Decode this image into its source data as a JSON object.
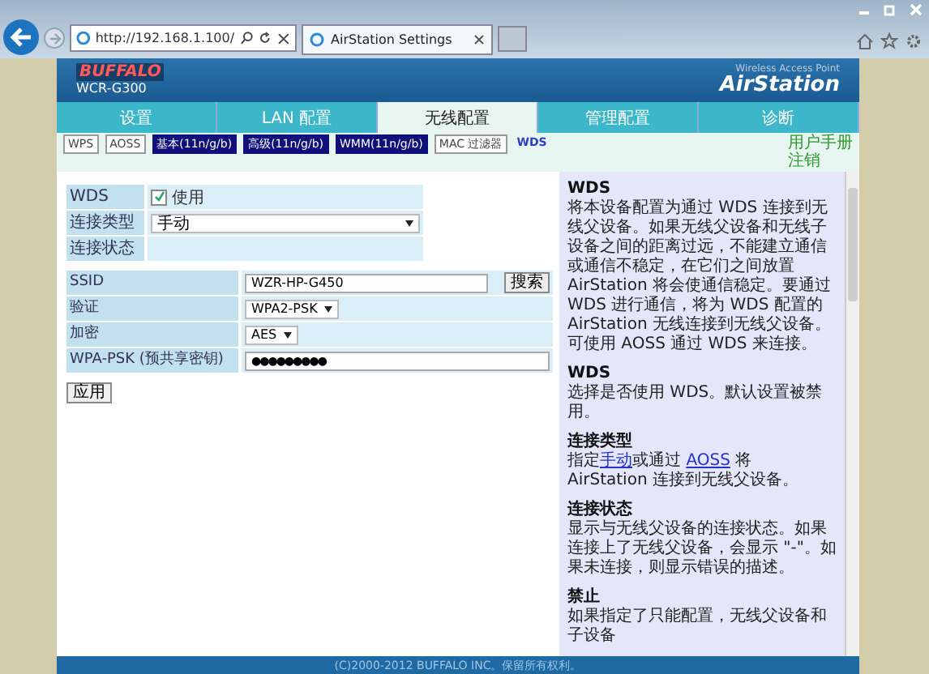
{
  "browser": {
    "url": "http://192.168.1.100/",
    "tab_title": "AirStation Settings"
  },
  "header": {
    "brand": "BUFFALO",
    "model": "WCR-G300",
    "product_sub": "Wireless Access Point",
    "product": "AirStation"
  },
  "nav_tabs": [
    {
      "label": "设置",
      "selected": false
    },
    {
      "label": "LAN 配置",
      "selected": false
    },
    {
      "label": "无线配置",
      "selected": true
    },
    {
      "label": "管理配置",
      "selected": false
    },
    {
      "label": "诊断",
      "selected": false
    }
  ],
  "sub_tabs": [
    {
      "label": "WPS",
      "kind": "plain"
    },
    {
      "label": "AOSS",
      "kind": "plain"
    },
    {
      "label": "基本(11n/g/b)",
      "kind": "filled"
    },
    {
      "label": "高级(11n/g/b)",
      "kind": "filled"
    },
    {
      "label": "WMM(11n/g/b)",
      "kind": "filled"
    },
    {
      "label": "MAC 过滤器",
      "kind": "plain"
    },
    {
      "label": "WDS",
      "kind": "current"
    }
  ],
  "user_links": [
    "用户手册",
    "注销"
  ],
  "wds_rows": [
    {
      "label": "WDS",
      "kind": "checkbox",
      "checked": true,
      "value": "使用"
    },
    {
      "label": "连接类型",
      "kind": "select",
      "value": "手动"
    },
    {
      "label": "连接状态",
      "kind": "empty"
    }
  ],
  "link_rows": [
    {
      "label": "SSID",
      "kind": "text",
      "value": "WZR-HP-G450",
      "button": "搜索"
    },
    {
      "label": "验证",
      "kind": "select",
      "value": "WPA2-PSK"
    },
    {
      "label": "加密",
      "kind": "select",
      "value": "AES"
    },
    {
      "label": "WPA-PSK (预共享密钥)",
      "kind": "password",
      "value": "●●●●●●●●●"
    }
  ],
  "apply_button": "应用",
  "help": [
    {
      "heading": "WDS",
      "parts": [
        {
          "kind": "text",
          "text": "将本设备配置为通过 WDS 连接到无线父设备。如果无线父设备和无线子设备之间的距离过远，不能建立通信或通信不稳定，在它们之间放置 AirStation 将会使通信稳定。要通过 WDS 进行通信，将为 WDS 配置的 AirStation 无线连接到无线父设备。可使用 AOSS 通过 WDS 来连接。"
        }
      ]
    },
    {
      "heading": "WDS",
      "parts": [
        {
          "kind": "text",
          "text": "选择是否使用 WDS。默认设置被禁用。"
        }
      ]
    },
    {
      "heading": "连接类型",
      "parts": [
        {
          "kind": "text",
          "text": "指定"
        },
        {
          "kind": "link",
          "text": "手动"
        },
        {
          "kind": "text",
          "text": "或通过 "
        },
        {
          "kind": "link",
          "text": "AOSS"
        },
        {
          "kind": "text",
          "text": " 将 AirStation 连接到无线父设备。"
        }
      ]
    },
    {
      "heading": "连接状态",
      "parts": [
        {
          "kind": "text",
          "text": "显示与无线父设备的连接状态。如果连接上了无线父设备，会显示 \"-\"。如果未连接，则显示错误的描述。"
        }
      ]
    },
    {
      "heading": "禁止",
      "parts": [
        {
          "kind": "text",
          "text": "如果指定了只能配置，无线父设备和子设备"
        }
      ]
    }
  ],
  "footer": "(C)2000-2012 BUFFALO INC。保留所有权利。"
}
